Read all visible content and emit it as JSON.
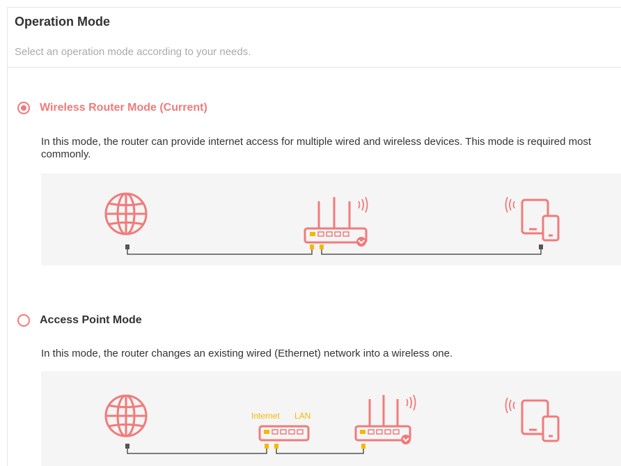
{
  "header": {
    "title": "Operation Mode",
    "subtitle": "Select an operation mode according to your needs."
  },
  "modes": [
    {
      "label": "Wireless Router Mode (Current)",
      "selected": true,
      "description": "In this mode, the router can provide internet access for multiple wired and wireless devices. This mode is required most commonly."
    },
    {
      "label": "Access Point Mode",
      "selected": false,
      "description": "In this mode, the router changes an existing wired (Ethernet) network into a wireless one.",
      "diagram_labels": {
        "internet": "Internet",
        "lan": "LAN"
      }
    }
  ],
  "colors": {
    "accent": "#f27a7a",
    "port": "#f5b800",
    "panel_bg": "#f5f5f5",
    "cable": "#555555"
  }
}
